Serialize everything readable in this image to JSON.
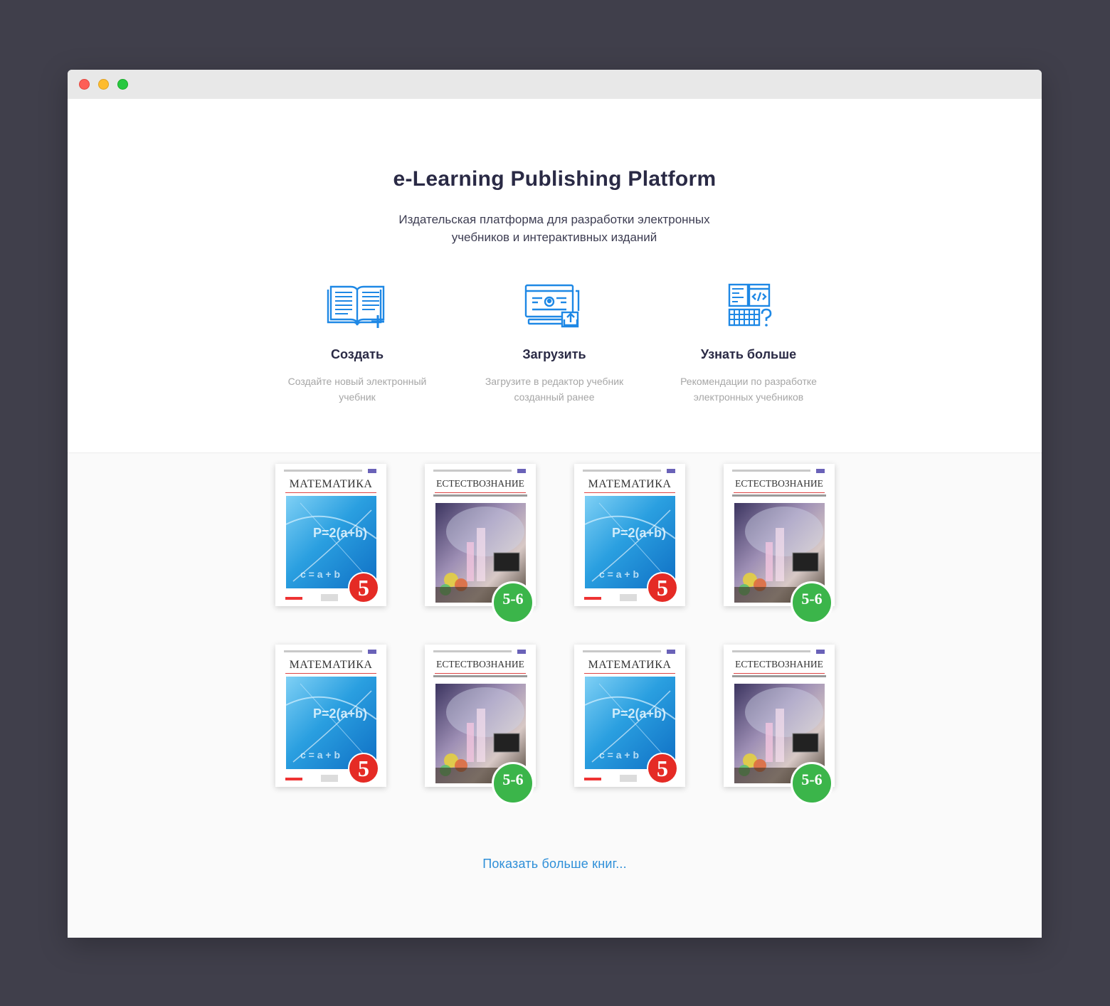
{
  "window": {
    "controls": [
      "close",
      "minimize",
      "maximize"
    ]
  },
  "hero": {
    "title": "e-Learning Publishing Platform",
    "subtitle": "Издательская платформа для разработки электронных учебников и интерактивных изданий"
  },
  "features": [
    {
      "icon": "open-book-plus-icon",
      "title": "Создать",
      "desc": "Создайте новый электронный учебник"
    },
    {
      "icon": "browser-upload-icon",
      "title": "Загрузить",
      "desc": "Загрузите в редактор учебник созданный ранее"
    },
    {
      "icon": "code-keyboard-question-icon",
      "title": "Узнать больше",
      "desc": "Рекомендации по разработке электронных учебников"
    }
  ],
  "books": [
    {
      "title": "МАТЕМАТИКА",
      "grade": "5"
    },
    {
      "title": "ЕСТЕСТВОЗНАНИЕ",
      "grade": "5-6"
    },
    {
      "title": "МАТЕМАТИКА",
      "grade": "5"
    },
    {
      "title": "ЕСТЕСТВОЗНАНИЕ",
      "grade": "5-6"
    },
    {
      "title": "МАТЕМАТИКА",
      "grade": "5"
    },
    {
      "title": "ЕСТЕСТВОЗНАНИЕ",
      "grade": "5-6"
    },
    {
      "title": "МАТЕМАТИКА",
      "grade": "5"
    },
    {
      "title": "ЕСТЕСТВОЗНАНИЕ",
      "grade": "5-6"
    }
  ],
  "show_more": "Показать больше книг...",
  "colors": {
    "accent": "#2e8fd8",
    "background": "#403f4b",
    "math_badge": "#e52b25",
    "science_badge": "#3bb54a"
  }
}
